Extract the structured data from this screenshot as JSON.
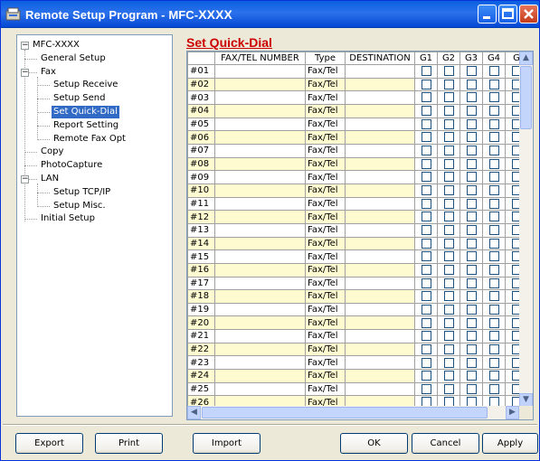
{
  "window": {
    "title_prefix": "Remote Setup Program - MFC-",
    "title_model": "XXXX"
  },
  "tree": {
    "root": "MFC-XXXX",
    "items": [
      {
        "label": "General Setup",
        "level": 1
      },
      {
        "label": "Fax",
        "level": 1
      },
      {
        "label": "Setup Receive",
        "level": 2
      },
      {
        "label": "Setup Send",
        "level": 2
      },
      {
        "label": "Set Quick-Dial",
        "level": 2,
        "selected": true
      },
      {
        "label": "Report Setting",
        "level": 2
      },
      {
        "label": "Remote Fax Opt",
        "level": 2
      },
      {
        "label": "Copy",
        "level": 1
      },
      {
        "label": "PhotoCapture",
        "level": 1
      },
      {
        "label": "LAN",
        "level": 1
      },
      {
        "label": "Setup TCP/IP",
        "level": 2
      },
      {
        "label": "Setup Misc.",
        "level": 2
      },
      {
        "label": "Initial Setup",
        "level": 1
      }
    ]
  },
  "section_title": "Set Quick-Dial",
  "grid": {
    "columns": [
      "",
      "FAX/TEL NUMBER",
      "Type",
      "DESTINATION",
      "G1",
      "G2",
      "G3",
      "G4",
      "G"
    ],
    "rows": [
      "#01",
      "#02",
      "#03",
      "#04",
      "#05",
      "#06",
      "#07",
      "#08",
      "#09",
      "#10",
      "#11",
      "#12",
      "#13",
      "#14",
      "#15",
      "#16",
      "#17",
      "#18",
      "#19",
      "#20",
      "#21",
      "#22",
      "#23",
      "#24",
      "#25",
      "#26"
    ],
    "type_value": "Fax/Tel"
  },
  "buttons": {
    "export": "Export",
    "print": "Print",
    "import": "Import",
    "ok": "OK",
    "cancel": "Cancel",
    "apply": "Apply"
  },
  "colors": {
    "title_bar": "#2b71ec",
    "section_title": "#cc0000",
    "selection": "#316ac5",
    "row_highlight": "#fffbd0"
  }
}
